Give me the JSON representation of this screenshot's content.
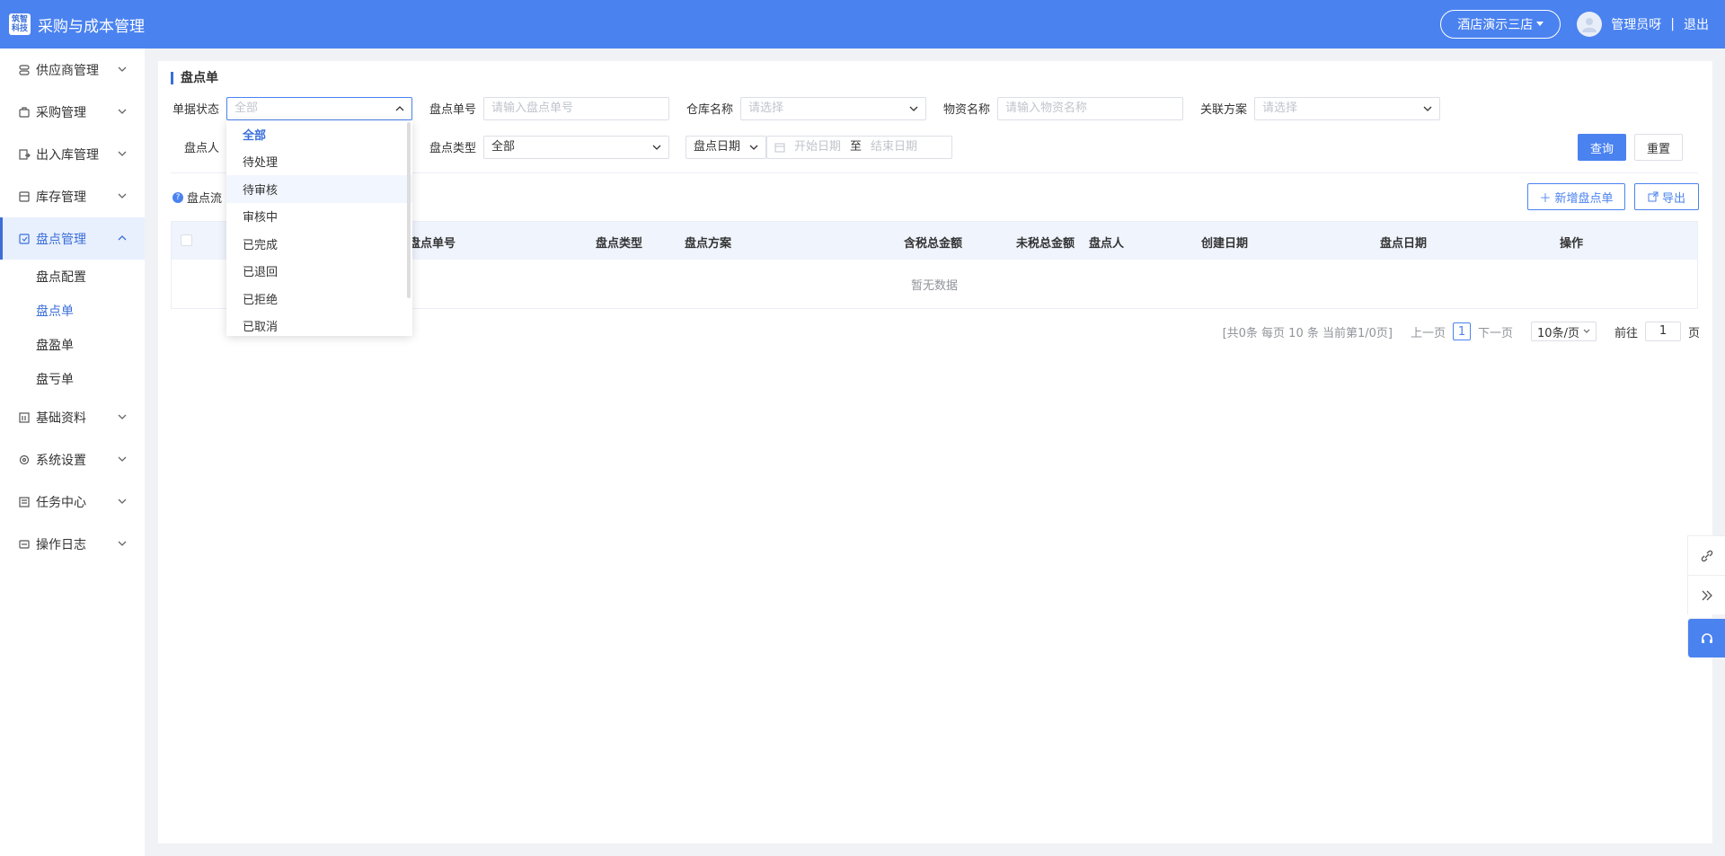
{
  "app": {
    "logo_line1": "筑智",
    "logo_line2": "科技",
    "title": "采购与成本管理"
  },
  "header": {
    "store": "酒店演示三店",
    "user": "管理员呀",
    "separator": "|",
    "logout": "退出"
  },
  "sidebar": {
    "items": [
      {
        "label": "供应商管理",
        "icon": "supplier-icon"
      },
      {
        "label": "采购管理",
        "icon": "cart-icon"
      },
      {
        "label": "出入库管理",
        "icon": "inout-icon"
      },
      {
        "label": "库存管理",
        "icon": "box-icon"
      },
      {
        "label": "盘点管理",
        "icon": "inventory-check-icon",
        "active": true
      },
      {
        "label": "基础资料",
        "icon": "book-icon"
      },
      {
        "label": "系统设置",
        "icon": "gear-icon"
      },
      {
        "label": "任务中心",
        "icon": "task-icon"
      },
      {
        "label": "操作日志",
        "icon": "log-icon"
      }
    ],
    "sub_items": [
      "盘点配置",
      "盘点单",
      "盘盈单",
      "盘亏单"
    ]
  },
  "page": {
    "title": "盘点单"
  },
  "filters": {
    "status_label": "单据状态",
    "status_value": "全部",
    "order_no_label": "盘点单号",
    "order_no_placeholder": "请输入盘点单号",
    "warehouse_label": "仓库名称",
    "warehouse_placeholder": "请选择",
    "material_label": "物资名称",
    "material_placeholder": "请输入物资名称",
    "plan_label": "关联方案",
    "plan_placeholder": "请选择",
    "person_label": "盘点人",
    "type_label": "盘点类型",
    "type_value": "全部",
    "date_type": "盘点日期",
    "start_placeholder": "开始日期",
    "to": "至",
    "end_placeholder": "结束日期",
    "query": "查询",
    "reset": "重置"
  },
  "toolbar": {
    "info": "盘点流",
    "add": "新增盘点单",
    "export": "导出"
  },
  "table": {
    "columns": [
      "盘点单号",
      "盘点类型",
      "盘点方案",
      "含税总金额",
      "未税总金额",
      "盘点人",
      "创建日期",
      "盘点日期",
      "操作"
    ],
    "empty": "暂无数据"
  },
  "pager": {
    "summary": "[共0条 每页 10 条 当前第1/0页]",
    "prev": "上一页",
    "current": "1",
    "next": "下一页",
    "size": "10条/页",
    "goto": "前往",
    "goto_value": "1",
    "page_unit": "页"
  },
  "dropdown": {
    "options": [
      "全部",
      "待处理",
      "待审核",
      "审核中",
      "已完成",
      "已退回",
      "已拒绝",
      "已取消"
    ],
    "selected_index": 0,
    "hover_index": 2
  },
  "colors": {
    "primary": "#4a82f0",
    "active_text": "#3b6fd8"
  }
}
